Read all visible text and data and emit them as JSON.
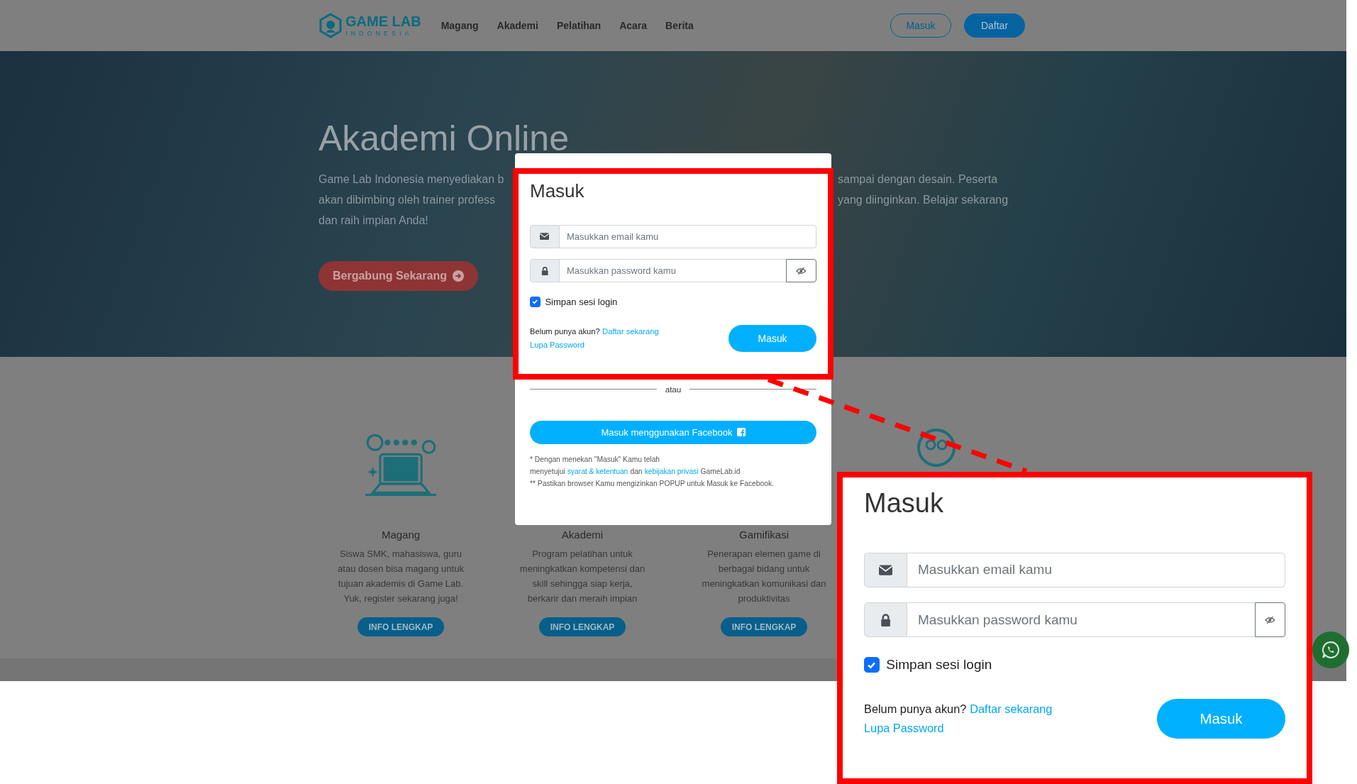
{
  "header": {
    "logo": {
      "title": "GAME LAB",
      "subtitle": "INDONESIA"
    },
    "nav": [
      "Magang",
      "Akademi",
      "Pelatihan",
      "Acara",
      "Berita"
    ],
    "buttons": [
      {
        "label": "Masuk",
        "kind": "outline"
      },
      {
        "label": "Daftar",
        "kind": "filled"
      }
    ]
  },
  "hero": {
    "title": "Akademi Online",
    "description_left": [
      "Game Lab Indonesia menyediakan b",
      "akan dibimbing oleh trainer profess",
      "dan raih impian Anda!"
    ],
    "description_right": [
      "sampai dengan desain. Peserta",
      "yang diinginkan. Belajar sekarang"
    ],
    "button": "Bergabung Sekarang"
  },
  "cards": [
    {
      "title": "Magang",
      "description": [
        "Siswa SMK, mahasiswa, guru",
        "atau dosen bisa magang untuk",
        "tujuan akademis di Game Lab.",
        "Yuk, register sekarang juga!"
      ],
      "button": "INFO LENGKAP"
    },
    {
      "title": "Akademi",
      "description": [
        "Program pelatihan untuk",
        "meningkatkan kompetensi dan",
        "skill sehingga siap kerja,",
        "berkarir dan meraih impian"
      ],
      "button": "INFO LENGKAP"
    },
    {
      "title": "Gamifikasi",
      "description": [
        "Penerapan elemen game di",
        "berbagai bidang untuk",
        "meningkatkan komunikasi dan",
        "produktivitas"
      ],
      "button": "INFO LENGKAP"
    }
  ],
  "login_modal": {
    "title": "Masuk",
    "email_placeholder": "Masukkan email kamu",
    "password_placeholder": "Masukkan password kamu",
    "remember": {
      "label": "Simpan sesi login",
      "checked": true
    },
    "signup": {
      "prompt": "Belum punya akun?",
      "link": "Daftar sekarang"
    },
    "forgot_link": "Lupa Password",
    "submit": "Masuk",
    "divider": "atau",
    "facebook_button": "Masuk menggunakan Facebook",
    "notes": [
      {
        "parts": [
          {
            "kind": "text",
            "text": "* Dengan menekan \"Masuk\" Kamu telah menyetujui"
          },
          {
            "kind": "link",
            "text": "syarat & ketentuan"
          },
          {
            "kind": "text",
            "text": "dan"
          },
          {
            "kind": "link",
            "text": "kebijakan privasi"
          },
          {
            "kind": "text",
            "text": "GameLab.id"
          }
        ]
      },
      {
        "parts": [
          {
            "kind": "text",
            "text": "** Pastikan browser Kamu mengizinkan POPUP untuk Masuk ke Facebook."
          }
        ]
      }
    ]
  },
  "zoom_inset": {
    "title": "Masuk",
    "email_placeholder": "Masukkan email kamu",
    "password_placeholder": "Masukkan password kamu",
    "remember": {
      "label": "Simpan sesi login",
      "checked": true
    },
    "signup": {
      "prompt": "Belum punya akun?",
      "link": "Daftar sekarang"
    },
    "forgot_link": "Lupa Password",
    "submit": "Masuk"
  }
}
